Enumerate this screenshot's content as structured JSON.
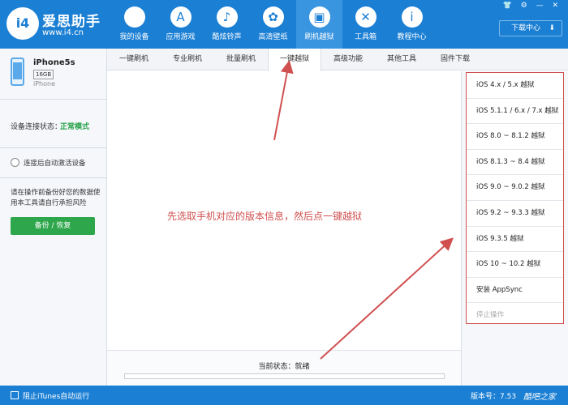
{
  "brand": {
    "logo_text": "i4",
    "name": "爱思助手",
    "url": "www.i4.cn"
  },
  "nav": [
    {
      "label": "我的设备",
      "icon": "apple-icon",
      "glyph": ""
    },
    {
      "label": "应用游戏",
      "icon": "app-store-icon",
      "glyph": "A"
    },
    {
      "label": "酷炫铃声",
      "icon": "bell-icon",
      "glyph": "♪"
    },
    {
      "label": "高清壁纸",
      "icon": "flower-icon",
      "glyph": "✿"
    },
    {
      "label": "刷机越狱",
      "icon": "box-icon",
      "glyph": "▣",
      "active": true
    },
    {
      "label": "工具箱",
      "icon": "tools-icon",
      "glyph": "✕"
    },
    {
      "label": "教程中心",
      "icon": "info-icon",
      "glyph": "i"
    }
  ],
  "window_controls": "👕 ⚙ — ✕",
  "download_center": "下载中心",
  "download_icon": "⬇",
  "device": {
    "name": "iPhone5s",
    "capacity": "16GB",
    "type": "iPhone"
  },
  "connection": {
    "label": "设备连接状态：",
    "status": "正常模式"
  },
  "auto_activate": "连接后自动激活设备",
  "tip": "请在操作前备份好您的数据使用本工具请自行承担风险",
  "backup_button": "备份 / 恢复",
  "tabs": [
    "一键刷机",
    "专业刷机",
    "批量刷机",
    "一键越狱",
    "高级功能",
    "其他工具",
    "固件下载"
  ],
  "active_tab": 3,
  "hint": "先选取手机对应的版本信息，然后点一键越狱",
  "status": {
    "label": "当前状态：就绪",
    "progress": 0
  },
  "jailbreak_options": [
    "iOS 4.x / 5.x 越狱",
    "iOS 5.1.1 / 6.x / 7.x 越狱",
    "iOS 8.0 ~ 8.1.2 越狱",
    "iOS 8.1.3 ~ 8.4 越狱",
    "iOS 9.0 ~ 9.0.2 越狱",
    "iOS 9.2 ~ 9.3.3 越狱",
    "iOS 9.3.5 越狱",
    "iOS 10 ~ 10.2 越狱",
    "安装 AppSync",
    "停止操作"
  ],
  "bottom": {
    "itunes_label": "阻止iTunes自动运行",
    "version": "版本号：7.53",
    "watermark": "酷吧之家"
  },
  "colors": {
    "primary": "#1b7fd4",
    "accent_green": "#2ea64b",
    "annotation_red": "#d05050"
  }
}
